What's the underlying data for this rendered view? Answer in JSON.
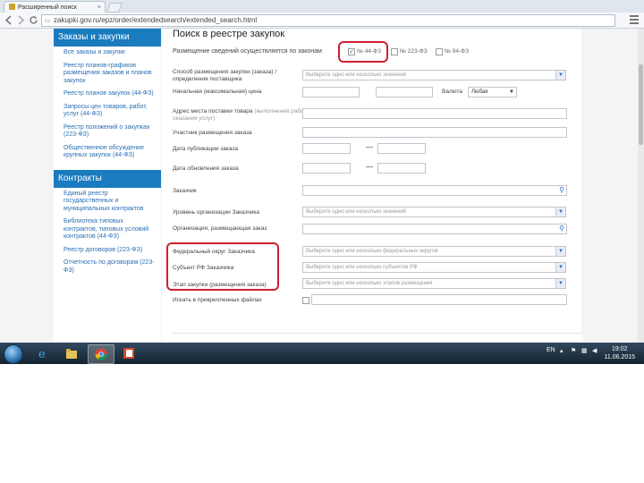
{
  "browser": {
    "tab_title": "Расширенный поиск",
    "tab_close": "×",
    "url": "zakupki.gov.ru/epz/order/extendedsearch/extended_search.html",
    "back_icon": "arrow-left-icon",
    "forward_icon": "arrow-right-icon",
    "reload_icon": "reload-icon"
  },
  "sidebar": {
    "section1_title": "Заказы и закупки",
    "section1_items": [
      "Все заказы и закупки",
      "Реестр планов-графиков размещения заказов и планов закупок",
      "Реестр планов закупок (44-ФЗ)",
      "Запросы цен товаров, работ, услуг (44-ФЗ)",
      "Реестр положений о закупках (223-ФЗ)",
      "Общественное обсуждение крупных закупок (44-ФЗ)"
    ],
    "section2_title": "Контракты",
    "section2_items": [
      "Единый реестр государственных и муниципальных контрактов",
      "Библиотека типовых контрактов, типовых условий контрактов (44-ФЗ)",
      "Реестр договоров (223-ФЗ)",
      "Отчетность по договорам (223-ФЗ)"
    ]
  },
  "main": {
    "title": "Поиск в реестре закупок",
    "law_label": "Размещение сведений осуществляется по законам",
    "laws": [
      "№ 44-ФЗ",
      "№ 223-ФЗ",
      "№ 94-ФЗ"
    ],
    "fields": {
      "method_label": "Способ размещения закупки (заказа) / определения поставщика",
      "method_placeholder": "Выберите одно или несколько значений",
      "price_label": "Начальная (максимальная) цена",
      "currency_label": "Валюта",
      "currency_value": "Любая",
      "place_label": "Адрес места поставки товара",
      "place_note": "(выполнения работ, оказания услуг)",
      "participant_label": "Участник размещения заказа",
      "pub_date_label": "Дата публикации заказа",
      "update_date_label": "Дата обновления заказа",
      "dash": "—",
      "customer_label": "Заказчик",
      "level_label": "Уровень организации Заказчика",
      "level_placeholder": "Выберите одно или несколько значений",
      "org_label": "Организация, размещающая заказ",
      "fed_district_label": "Федеральный округ Заказчика",
      "fed_district_placeholder": "Выберите одно или несколько федеральных округов",
      "subject_label": "Субъект РФ Заказчика",
      "subject_placeholder": "Выберите одно или несколько субъектов РФ",
      "stage_label": "Этап закупки (размещения заказа)",
      "stage_placeholder": "Выберите одно или несколько этапов размещения",
      "only_label": "Искать в прикрепленных файлах"
    }
  },
  "taskbar": {
    "lang": "EN",
    "time": "19:02",
    "date": "11.06.2015"
  },
  "colors": {
    "accent": "#1b7bbf",
    "highlight": "#d0202e",
    "link": "#2a6fb5"
  }
}
